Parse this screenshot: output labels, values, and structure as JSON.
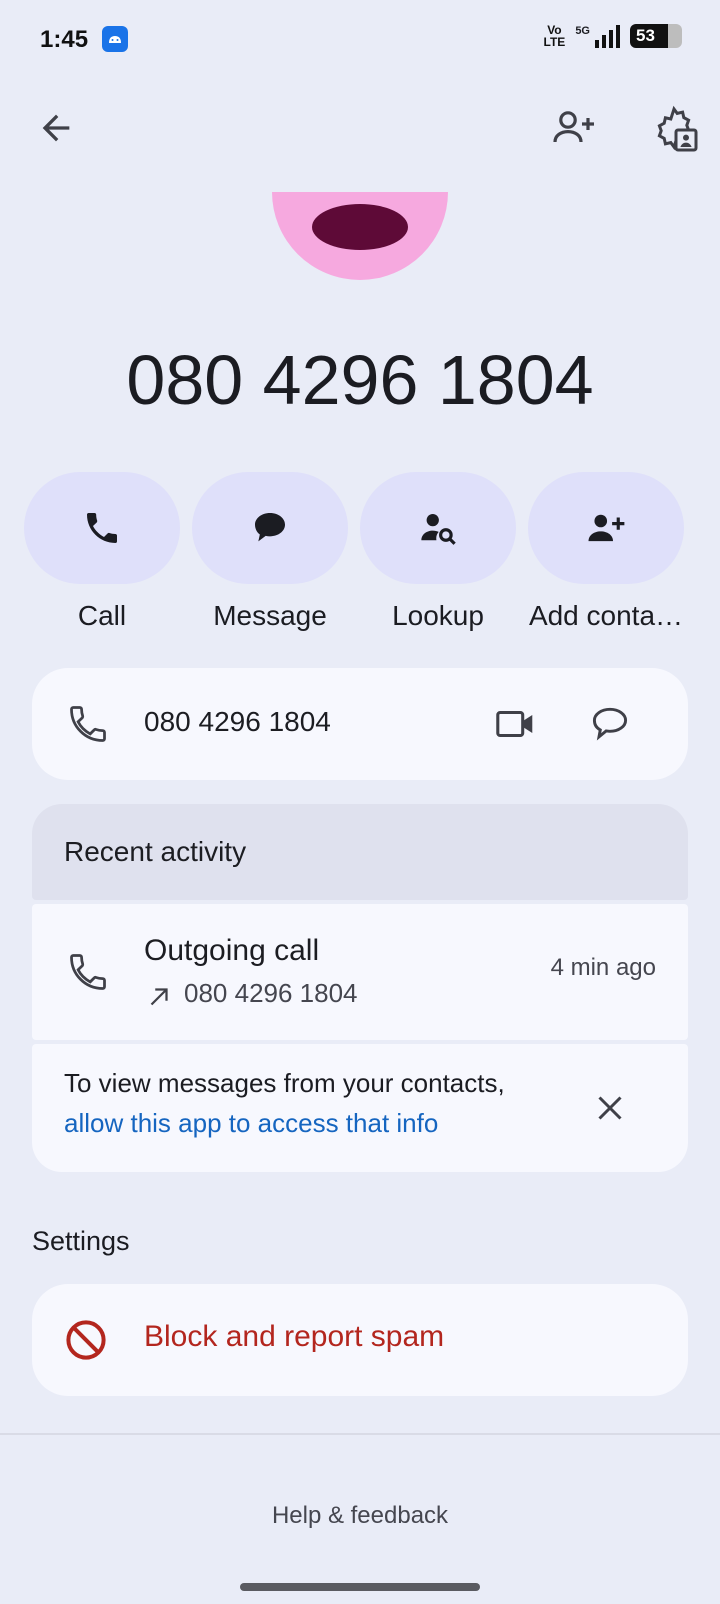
{
  "status_bar": {
    "time": "1:45",
    "network_label_top": "Vo",
    "network_label_bottom": "LTE",
    "network_type": "5G",
    "battery": "53"
  },
  "header": {
    "back_icon": "arrow-left-icon",
    "add_contact_icon": "person-add-icon",
    "settings_icon": "settings-person-icon"
  },
  "contact": {
    "display_number": "080 4296 1804",
    "avatar_colors": {
      "face": "#f6a9df",
      "mouth": "#5e0a37"
    }
  },
  "actions": [
    {
      "label": "Call",
      "icon": "phone-icon"
    },
    {
      "label": "Message",
      "icon": "message-bubble-icon"
    },
    {
      "label": "Lookup",
      "icon": "person-search-icon"
    },
    {
      "label": "Add conta…",
      "icon": "person-add-icon"
    }
  ],
  "phone_row": {
    "number": "080 4296 1804",
    "video_icon": "video-camera-icon",
    "message_icon": "chat-outline-icon"
  },
  "recent_activity": {
    "header": "Recent activity",
    "item": {
      "title": "Outgoing call",
      "number": "080 4296 1804",
      "time": "4 min ago"
    }
  },
  "message_prompt": {
    "text": "To view messages from your contacts,",
    "link": "allow this app to access that info"
  },
  "settings": {
    "header": "Settings",
    "block_label": "Block and report spam"
  },
  "footer": {
    "help": "Help & feedback"
  },
  "colors": {
    "background": "#e9ecf7",
    "action_pill": "#dfe0fa",
    "link": "#1565c0",
    "danger": "#b3261e"
  }
}
